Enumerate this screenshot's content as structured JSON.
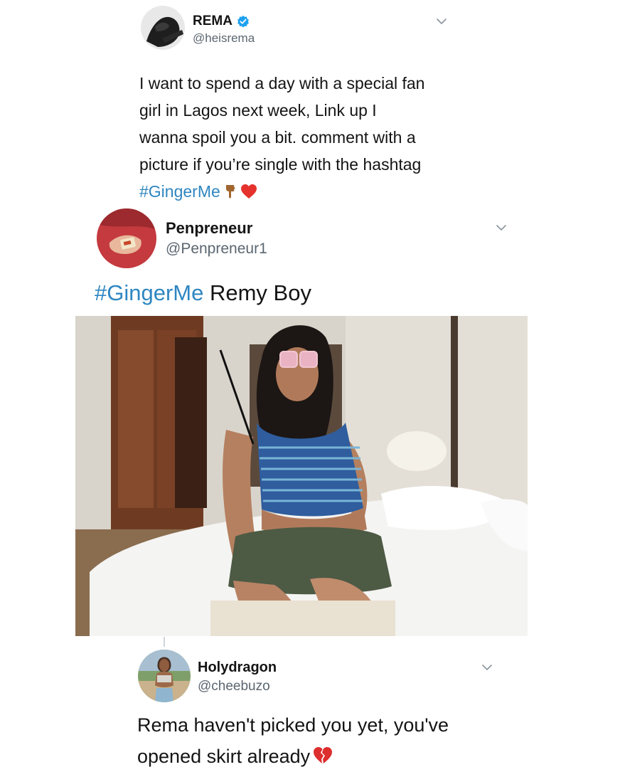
{
  "tweets": [
    {
      "name": "REMA",
      "handle": "@heisrema",
      "verified": true,
      "text_lines": [
        "I want to spend a day with a special fan",
        "girl in Lagos next week, Link up I",
        "wanna spoil you a bit. comment with a",
        "picture if you’re single with the hashtag"
      ],
      "hashtag": "#GingerMe",
      "emojis": [
        "backhand-index-pointing-down-icon",
        "red-heart-icon"
      ]
    },
    {
      "name": "Penpreneur",
      "handle": "@Penpreneur1",
      "hashtag": "#GingerMe",
      "text": "Remy Boy"
    },
    {
      "name": "Holydragon",
      "handle": "@cheebuzo",
      "text_lines": [
        "Rema haven't picked you yet, you've",
        "opened skirt already"
      ],
      "emojis": [
        "broken-heart-icon"
      ]
    }
  ],
  "colors": {
    "hashtag": "#2e86c1",
    "verified": "#1da1f2",
    "handle": "#5b6670",
    "text": "#141414"
  }
}
